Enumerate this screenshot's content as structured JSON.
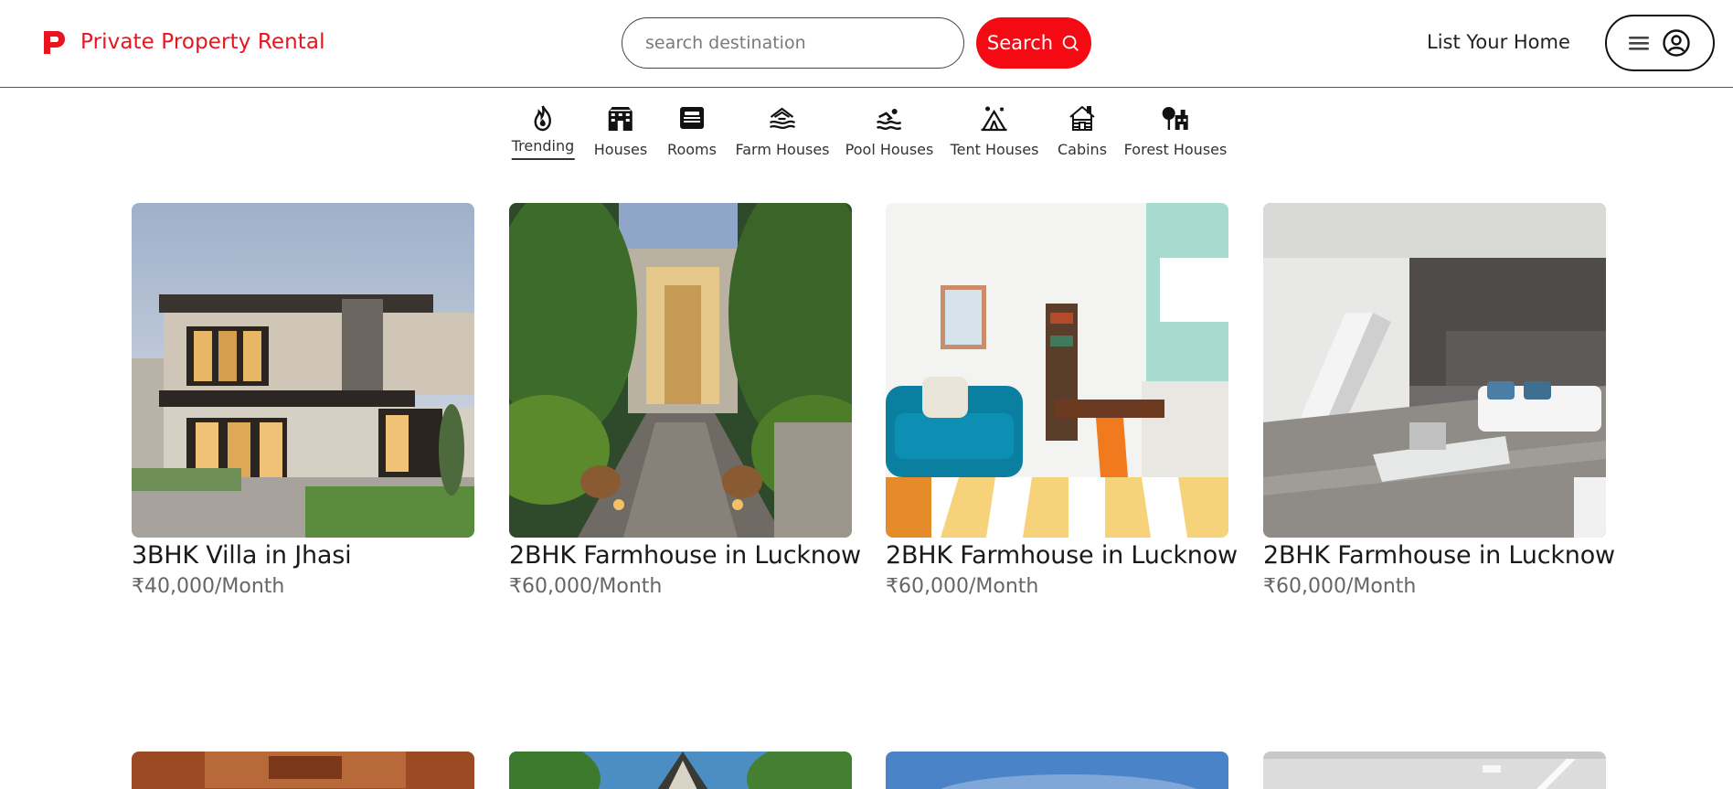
{
  "brand": {
    "name": "Private Property Rental",
    "color": "#e8141e"
  },
  "search": {
    "placeholder": "search destination",
    "value": "",
    "button_label": "Search",
    "button_color": "#f50a14"
  },
  "header": {
    "list_home_label": "List Your Home"
  },
  "categories": [
    {
      "label": "Trending",
      "icon": "flame-icon",
      "active": true
    },
    {
      "label": "Houses",
      "icon": "building-icon",
      "active": false
    },
    {
      "label": "Rooms",
      "icon": "bed-icon",
      "active": false
    },
    {
      "label": "Farm Houses",
      "icon": "barn-icon",
      "active": false
    },
    {
      "label": "Pool Houses",
      "icon": "swimmer-icon",
      "active": false
    },
    {
      "label": "Tent Houses",
      "icon": "tent-icon",
      "active": false
    },
    {
      "label": "Cabins",
      "icon": "cabin-icon",
      "active": false
    },
    {
      "label": "Forest Houses",
      "icon": "tree-house-icon",
      "active": false
    }
  ],
  "listings": [
    {
      "title": "3BHK Villa in Jhasi",
      "price": "₹40,000/Month",
      "image": "modern-villa-photo"
    },
    {
      "title": "2BHK Farmhouse in Lucknow",
      "price": "₹60,000/Month",
      "image": "farmhouse-entrance-photo"
    },
    {
      "title": "2BHK Farmhouse in Lucknow",
      "price": "₹60,000/Month",
      "image": "living-room-kitchen-photo"
    },
    {
      "title": "2BHK Farmhouse in Lucknow",
      "price": "₹60,000/Month",
      "image": "modern-interior-staircase-photo"
    }
  ],
  "listings_row2": [
    {
      "image": "wooden-ceiling-photo"
    },
    {
      "image": "tropical-aframe-photo"
    },
    {
      "image": "blue-sky-photo"
    },
    {
      "image": "white-ceiling-photo"
    }
  ]
}
